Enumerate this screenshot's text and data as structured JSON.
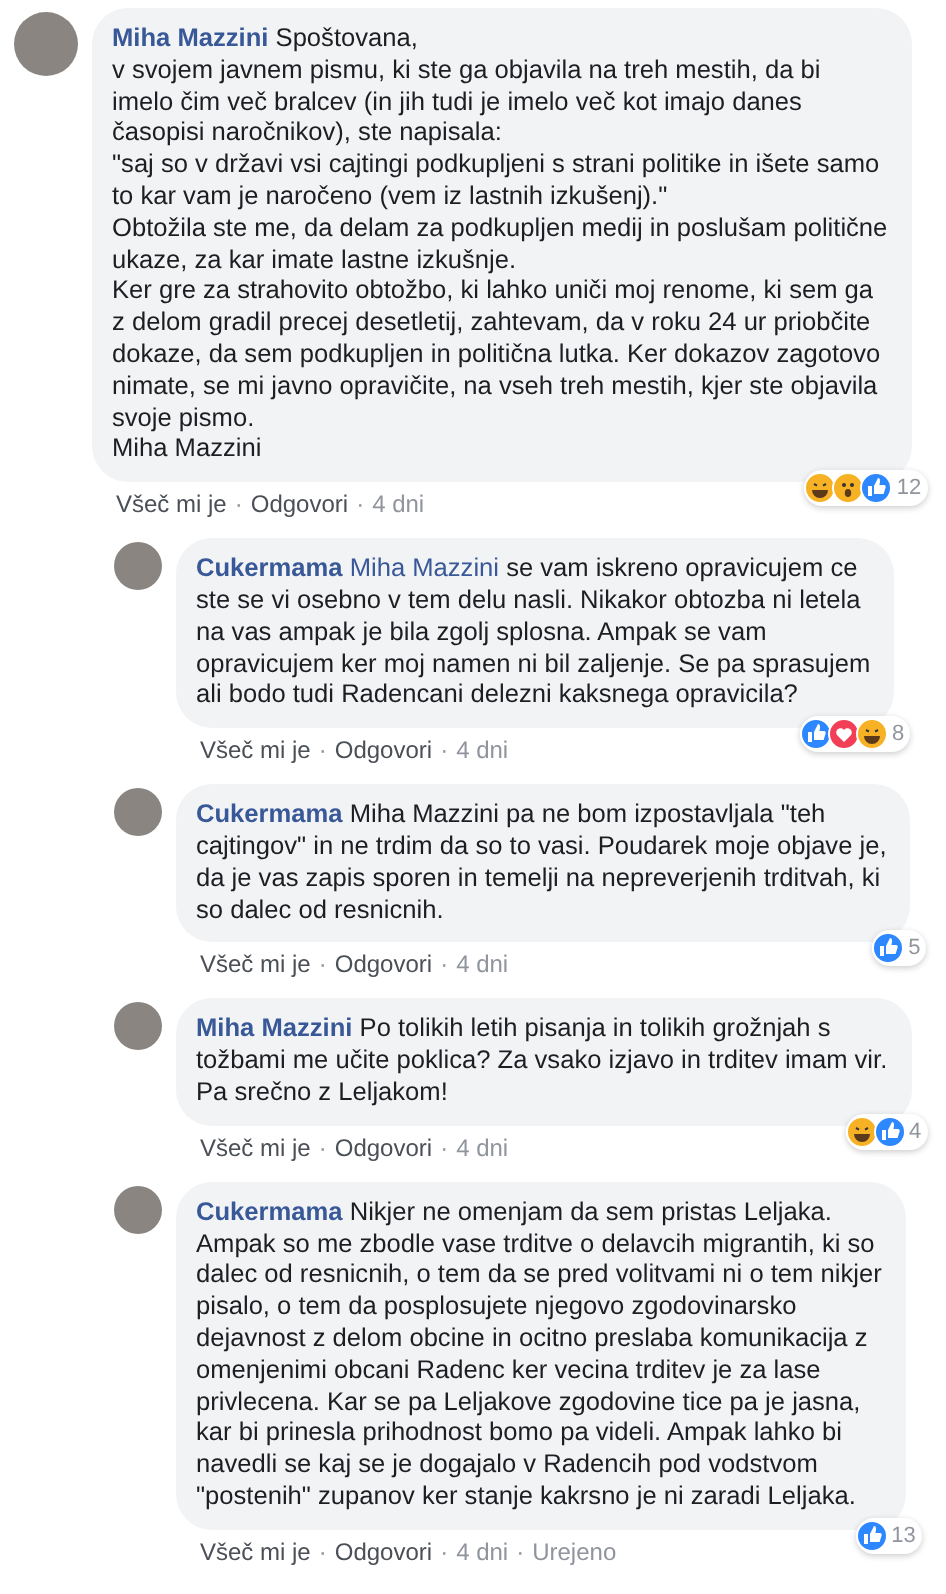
{
  "comments": [
    {
      "author": "Miha Mazzini",
      "reply": false,
      "lines": [
        "Spoštovana,",
        "v svojem javnem pismu, ki ste ga objavila na treh mestih, da bi",
        "imelo čim več bralcev (in jih tudi je imelo več kot imajo danes",
        "časopisi naročnikov), ste napisala:",
        "\"saj so v državi vsi cajtingi podkupljeni s strani politike in išete samo",
        "to kar vam je naročeno (vem iz lastnih izkušenj).\"",
        "Obtožila ste me, da delam za podkupljen medij in poslušam politične",
        "ukaze, za kar imate lastne izkušnje.",
        "Ker gre za strahovito obtožbo, ki lahko uniči moj renome, ki sem ga",
        "z delom gradil precej desetletij, zahtevam, da v roku 24 ur priobčite",
        "dokaze, da sem podkupljen in politična lutka. Ker dokazov zagotovo",
        "nimate, se mi javno opravičite, na vseh treh mestih, kjer ste objavila",
        "svoje pismo.",
        "Miha Mazzini"
      ],
      "reactions": [
        {
          "kind": "haha"
        },
        {
          "kind": "wow"
        },
        {
          "kind": "like"
        }
      ],
      "count": "12",
      "actions": [
        "Všeč mi je",
        "Odgovori",
        "4 dni"
      ]
    },
    {
      "author": "Cukermama",
      "reply": true,
      "mention": "Miha Mazzini",
      "lines": [
        "se vam iskreno opravicujem ce",
        "ste se vi osebno v tem delu nasli. Nikakor obtozba ni letela",
        "na vas ampak je bila zgolj splosna. Ampak se vam",
        "opravicujem ker moj namen ni bil zaljenje. Se pa sprasujem",
        "ali bodo tudi Radencani delezni kaksnega opravicila?"
      ],
      "reactions": [
        {
          "kind": "like"
        },
        {
          "kind": "love"
        },
        {
          "kind": "haha"
        }
      ],
      "count": "8",
      "actions": [
        "Všeč mi je",
        "Odgovori",
        "4 dni"
      ]
    },
    {
      "author": "Cukermama",
      "reply": true,
      "lines": [
        "Miha Mazzini pa ne bom izpostavljala \"teh",
        "cajtingov\" in ne trdim da so to vasi. Poudarek moje objave je,",
        "da je vas zapis sporen in temelji na nepreverjenih trditvah, ki",
        "so dalec od resnicnih."
      ],
      "reactions": [
        {
          "kind": "like"
        }
      ],
      "count": "5",
      "actions": [
        "Všeč mi je",
        "Odgovori",
        "4 dni"
      ]
    },
    {
      "author": "Miha Mazzini",
      "reply": true,
      "lines": [
        "Po tolikih letih pisanja in tolikih grožnjah s",
        "tožbami me učite poklica? Za vsako izjavo in trditev imam vir.",
        "Pa srečno z Leljakom!"
      ],
      "reactions": [
        {
          "kind": "haha"
        },
        {
          "kind": "like"
        }
      ],
      "count": "4",
      "actions": [
        "Všeč mi je",
        "Odgovori",
        "4 dni"
      ]
    },
    {
      "author": "Cukermama",
      "reply": true,
      "lines": [
        "Nikjer ne omenjam da sem pristas Leljaka.",
        "Ampak so me zbodle vase trditve o delavcih migrantih, ki so",
        "dalec od resnicnih, o tem da se pred volitvami ni o tem nikjer",
        "pisalo, o tem da posplosujete njegovo zgodovinarsko",
        "dejavnost z delom obcine in ocitno preslaba komunikacija z",
        "omenjenimi obcani Radenc ker vecina trditev je za lase",
        "privlecena. Kar se pa Leljakove zgodovine tice pa je jasna,",
        "kar bi prinesla prihodnost bomo pa videli. Ampak lahko bi",
        "navedli se kaj se je dogajalo v Radencih pod vodstvom",
        "\"postenih\" zupanov ker stanje kakrsno je ni zaradi Leljaka."
      ],
      "reactions": [
        {
          "kind": "like"
        }
      ],
      "count": "13",
      "actions": [
        "Všeč mi je",
        "Odgovori",
        "4 dni",
        "Urejeno"
      ]
    }
  ],
  "separator": "·"
}
